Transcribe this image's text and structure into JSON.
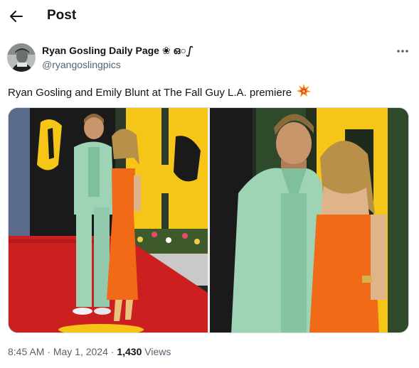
{
  "header": {
    "title": "Post"
  },
  "author": {
    "name": "Ryan Gosling Daily Page ❀ ഒ○ഽ",
    "handle": "@ryangoslingpics"
  },
  "post": {
    "text": "Ryan Gosling and Emily Blunt at The Fall Guy L.A. premiere",
    "emoji": "collision-icon"
  },
  "meta": {
    "time": "8:45 AM",
    "separator": " · ",
    "date": "May 1, 2024",
    "views_count": "1,430",
    "views_label": " Views"
  },
  "colors": {
    "text": "#0f1419",
    "secondary": "#536471",
    "border": "#cfd9de",
    "backdrop_yellow": "#f5c518",
    "red_carpet": "#d32020",
    "suit_mint": "#9ed3b6",
    "dress_orange": "#f06a17"
  }
}
